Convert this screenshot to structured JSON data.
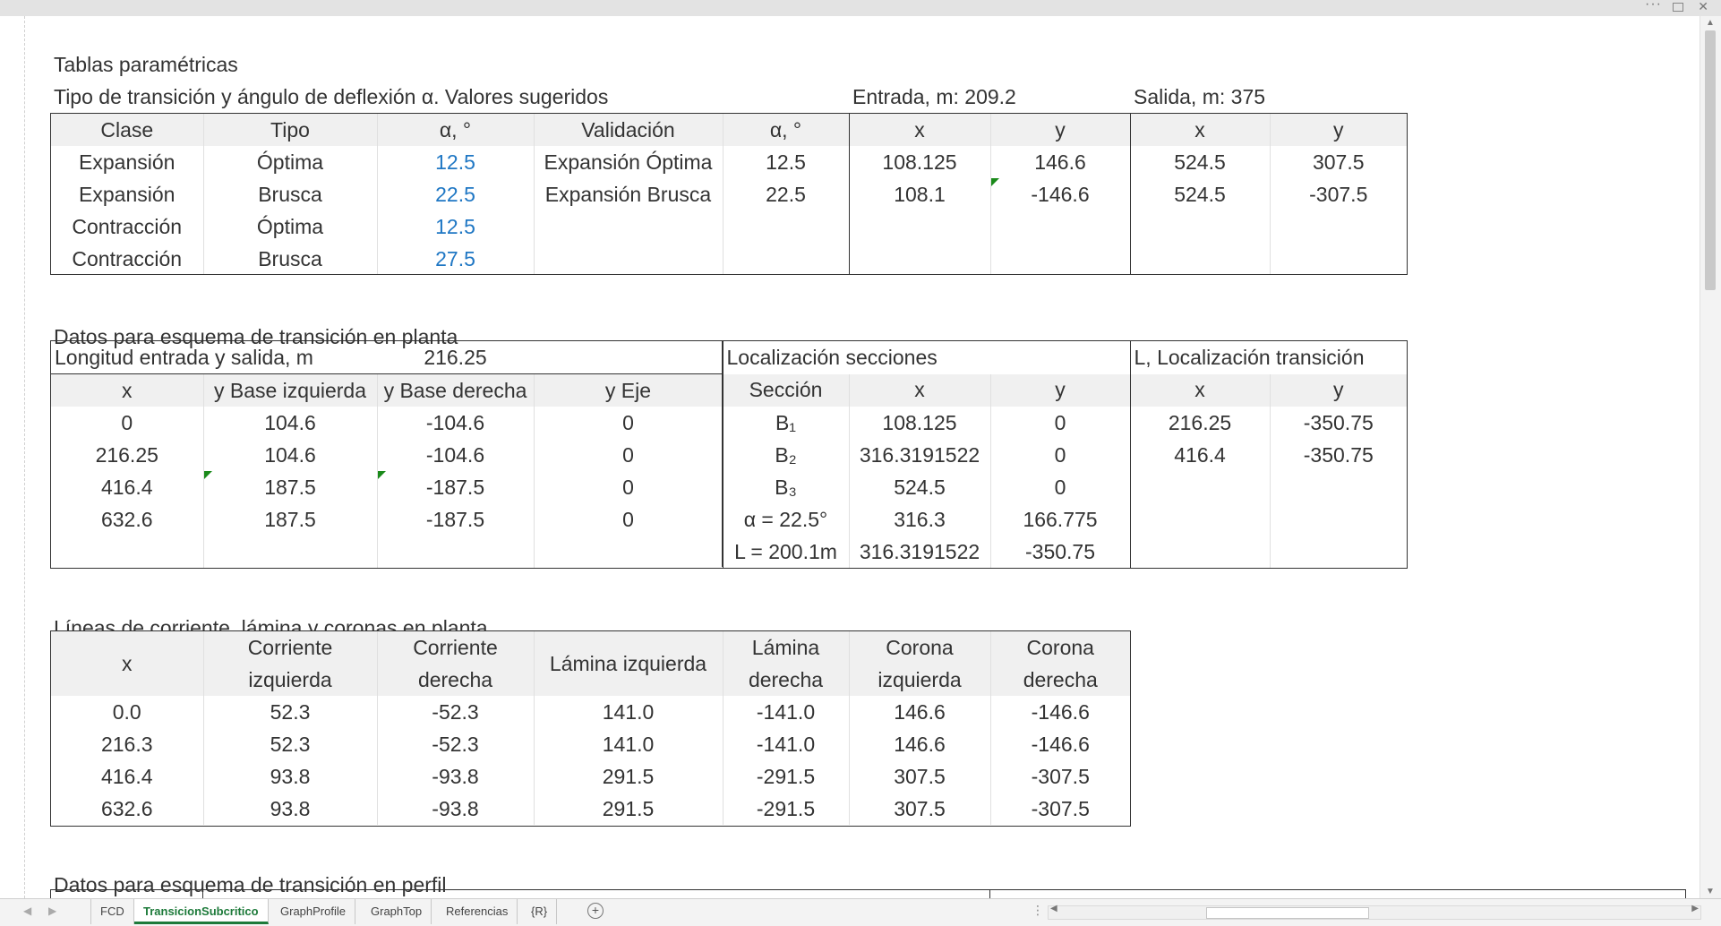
{
  "window": {
    "more_glyph": "···",
    "close_glyph": "✕"
  },
  "sections": {
    "parametric_title": "Tablas paramétricas",
    "transition_title": "Tipo de transición y ángulo de deflexión α. Valores sugeridos",
    "entry_label": "Entrada, m: 209.2",
    "exit_label": "Salida, m: 375",
    "plan_title": "Datos para esquema de transición en planta",
    "stream_title": "Líneas de corriente, lámina y coronas en planta",
    "profile_title": "Datos para esquema de transición en perfil"
  },
  "table1": {
    "headers": [
      "Clase",
      "Tipo",
      "α, °",
      "Validación",
      "α, °",
      "x",
      "y",
      "x",
      "y"
    ],
    "rows": [
      [
        "Expansión",
        "Óptima",
        "12.5",
        "Expansión Óptima",
        "12.5",
        "108.125",
        "146.6",
        "524.5",
        "307.5"
      ],
      [
        "Expansión",
        "Brusca",
        "22.5",
        "Expansión Brusca",
        "22.5",
        "108.1",
        "-146.6",
        "524.5",
        "-307.5"
      ],
      [
        "Contracción",
        "Óptima",
        "12.5",
        "",
        "",
        "",
        "",
        "",
        ""
      ],
      [
        "Contracción",
        "Brusca",
        "27.5",
        "",
        "",
        "",
        "",
        "",
        ""
      ]
    ]
  },
  "table2": {
    "length_label": "Longitud entrada y salida, m",
    "length_value": "216.25",
    "loc_sections_label": "Localización secciones",
    "loc_transition_label": "L, Localización transición",
    "headers": [
      "x",
      "y Base izquierda",
      "y Base derecha",
      "y Eje",
      "Sección",
      "x",
      "y",
      "x",
      "y"
    ],
    "rows": [
      [
        "0",
        "104.6",
        "-104.6",
        "0",
        "B₁",
        "108.125",
        "0",
        "216.25",
        "-350.75"
      ],
      [
        "216.25",
        "104.6",
        "-104.6",
        "0",
        "B₂",
        "316.3191522",
        "0",
        "416.4",
        "-350.75"
      ],
      [
        "416.4",
        "187.5",
        "-187.5",
        "0",
        "B₃",
        "524.5",
        "0",
        "",
        ""
      ],
      [
        "632.6",
        "187.5",
        "-187.5",
        "0",
        "α = 22.5°",
        "316.3",
        "166.775",
        "",
        ""
      ],
      [
        "",
        "",
        "",
        "",
        "L = 200.1m",
        "316.3191522",
        "-350.75",
        "",
        ""
      ]
    ]
  },
  "table3": {
    "headers": [
      [
        "x",
        ""
      ],
      [
        "Corriente",
        "izquierda"
      ],
      [
        "Corriente",
        "derecha"
      ],
      [
        "Lámina izquierda",
        ""
      ],
      [
        "Lámina",
        "derecha"
      ],
      [
        "Corona",
        "izquierda"
      ],
      [
        "Corona",
        "derecha"
      ]
    ],
    "rows": [
      [
        "0.0",
        "52.3",
        "-52.3",
        "141.0",
        "-141.0",
        "146.6",
        "-146.6"
      ],
      [
        "216.3",
        "52.3",
        "-52.3",
        "141.0",
        "-141.0",
        "146.6",
        "-146.6"
      ],
      [
        "416.4",
        "93.8",
        "-93.8",
        "291.5",
        "-291.5",
        "307.5",
        "-307.5"
      ],
      [
        "632.6",
        "93.8",
        "-93.8",
        "291.5",
        "-291.5",
        "307.5",
        "-307.5"
      ]
    ]
  },
  "tabs": [
    {
      "label": "FCD",
      "active": false
    },
    {
      "label": "TransicionSubcritico",
      "active": true
    },
    {
      "label": "GraphProfile",
      "active": false
    },
    {
      "label": "GraphTop",
      "active": false
    },
    {
      "label": "Referencias",
      "active": false
    },
    {
      "label": "{R}",
      "active": false
    }
  ],
  "colors": {
    "accent_tab": "#1d7a3a",
    "input_values": "#1f77c4",
    "comment_marker": "#1a8a1a"
  }
}
